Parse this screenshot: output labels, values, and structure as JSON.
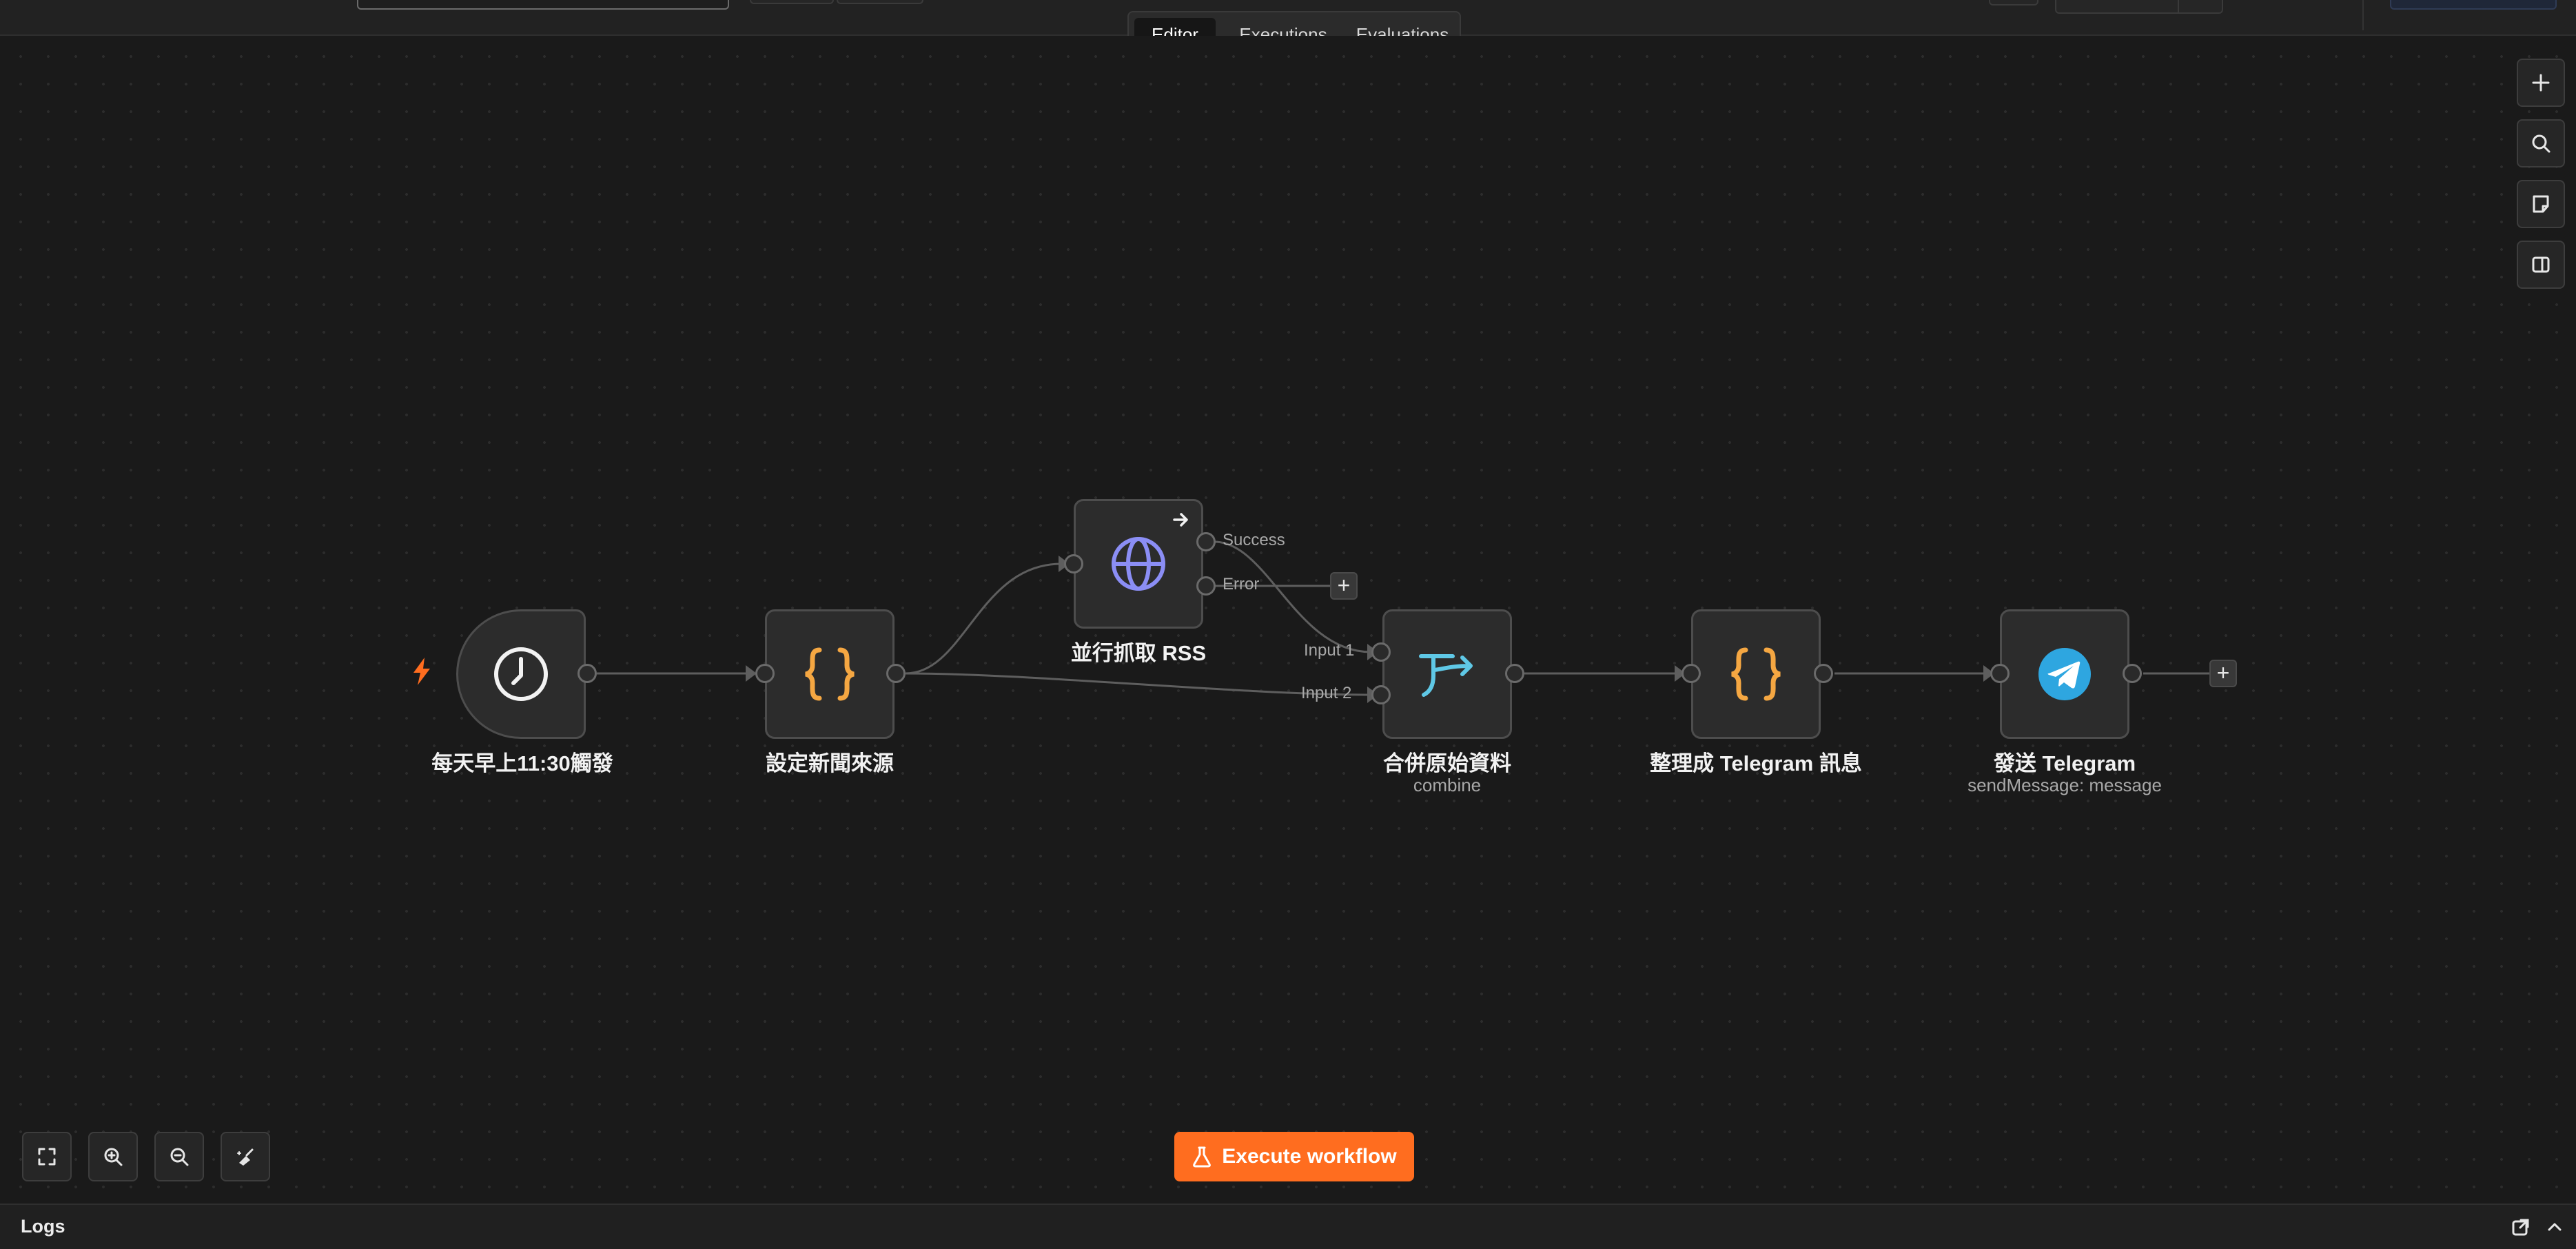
{
  "header": {
    "tabs": [
      {
        "label": "Editor",
        "active": true
      },
      {
        "label": "Executions",
        "active": false
      },
      {
        "label": "Evaluations",
        "active": false
      }
    ]
  },
  "nodes": [
    {
      "id": "trigger",
      "label": "每天早上11:30觸發",
      "icon": "clock-icon"
    },
    {
      "id": "set-sources",
      "label": "設定新聞來源",
      "icon": "code-braces-icon"
    },
    {
      "id": "fetch-rss",
      "label": "並行抓取 RSS",
      "icon": "globe-icon"
    },
    {
      "id": "merge",
      "label": "合併原始資料",
      "subtitle": "combine",
      "icon": "merge-icon"
    },
    {
      "id": "format-message",
      "label": "整理成 Telegram 訊息",
      "icon": "code-braces-icon"
    },
    {
      "id": "send-telegram",
      "label": "發送 Telegram",
      "subtitle": "sendMessage: message",
      "icon": "telegram-icon"
    }
  ],
  "ports": {
    "success": "Success",
    "error": "Error",
    "input1": "Input 1",
    "input2": "Input 2"
  },
  "canvas_controls": {
    "add": "plus-icon",
    "search": "search-icon",
    "sticky": "sticky-note-icon",
    "panel": "panel-toggle-icon"
  },
  "zoom_controls": [
    "fit-view-icon",
    "zoom-in-icon",
    "zoom-out-icon",
    "tidy-up-icon"
  ],
  "execute_button": {
    "label": "Execute workflow"
  },
  "logs": {
    "title": "Logs"
  },
  "colors": {
    "accent": "#ff6d1f",
    "braces": "#f5a742",
    "globe": "#8b8ef5",
    "merge": "#5fc8e6",
    "telegram": "#2ea6e0",
    "background": "#1a1a1a"
  }
}
